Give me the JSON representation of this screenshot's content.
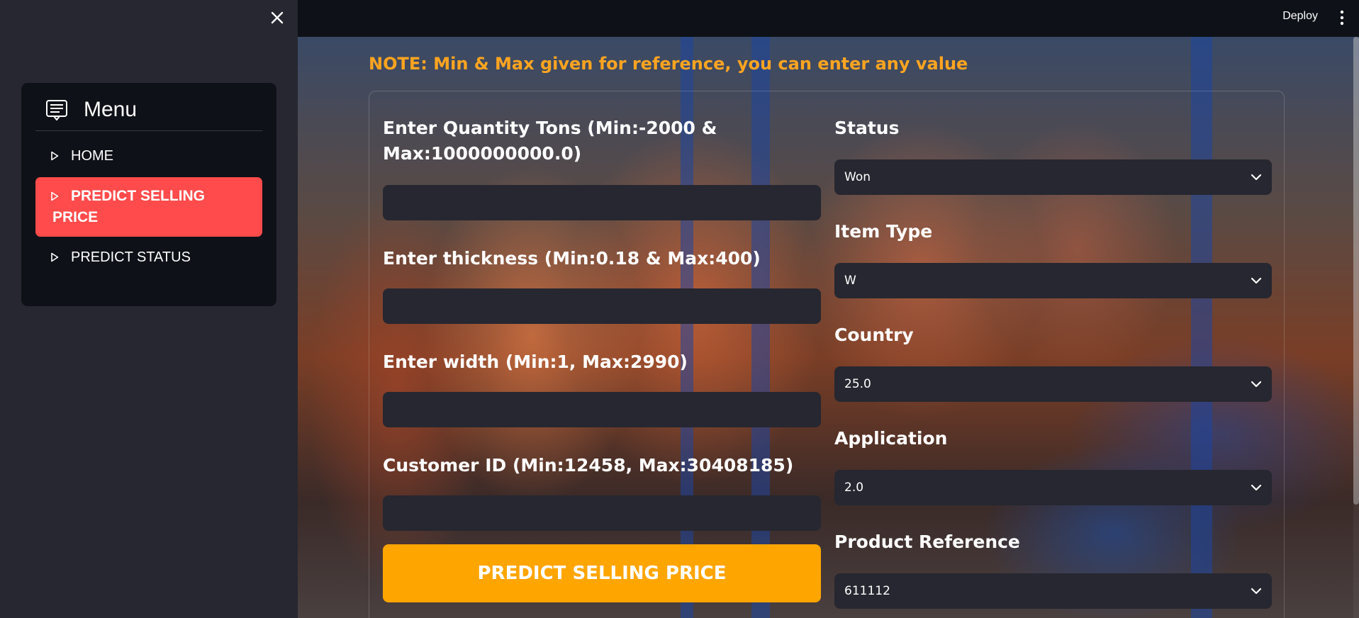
{
  "sidebar": {
    "close_icon": "close-icon",
    "menu_title": "Menu",
    "items": [
      {
        "label": "HOME",
        "active": false
      },
      {
        "label": "PREDICT SELLING PRICE",
        "active": true
      },
      {
        "label": "PREDICT STATUS",
        "active": false
      }
    ]
  },
  "topbar": {
    "deploy_label": "Deploy"
  },
  "main": {
    "note": "NOTE: Min & Max given for reference, you can enter any value",
    "left_fields": [
      {
        "label": "Enter Quantity Tons (Min:-2000 & Max:1000000000.0)",
        "value": ""
      },
      {
        "label": "Enter thickness (Min:0.18 & Max:400)",
        "value": ""
      },
      {
        "label": "Enter width (Min:1, Max:2990)",
        "value": ""
      },
      {
        "label": "Customer ID (Min:12458, Max:30408185)",
        "value": ""
      }
    ],
    "right_fields": [
      {
        "label": "Status",
        "value": "Won"
      },
      {
        "label": "Item Type",
        "value": "W"
      },
      {
        "label": "Country",
        "value": "25.0"
      },
      {
        "label": "Application",
        "value": "2.0"
      },
      {
        "label": "Product Reference",
        "value": "611112"
      }
    ],
    "predict_button": "PREDICT SELLING PRICE"
  },
  "colors": {
    "accent": "#ff4b4b",
    "note": "#ffa421",
    "button": "#ffa500",
    "input_bg": "#262730",
    "sidebar_bg": "#262730",
    "app_bg": "#0e1117"
  }
}
